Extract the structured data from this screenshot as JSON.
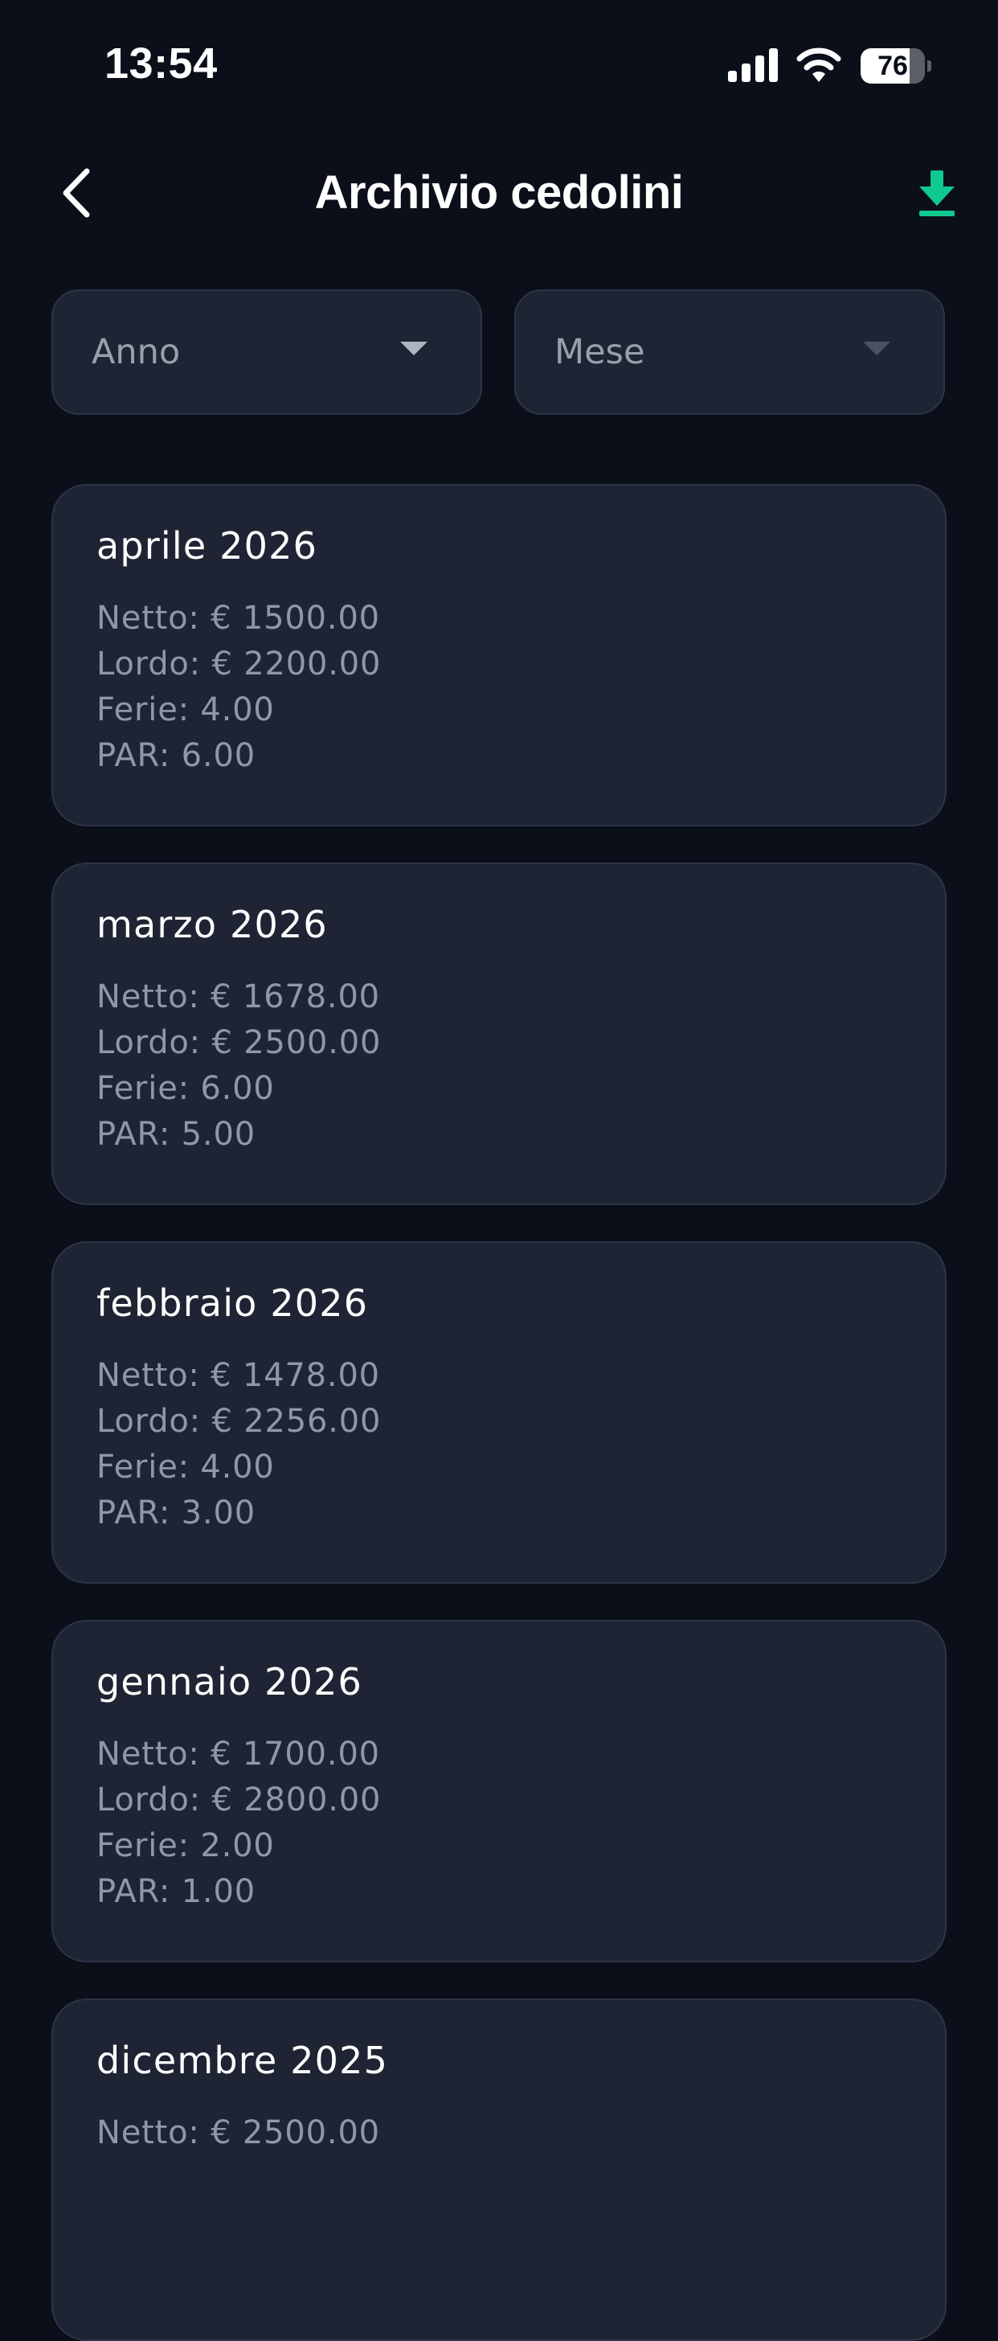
{
  "status_bar": {
    "time": "13:54",
    "battery_percent": "76",
    "battery_level": 0.76,
    "icons": [
      "signal-icon",
      "wifi-icon",
      "battery-icon"
    ]
  },
  "header": {
    "title": "Archivio cedolini",
    "back_icon": "chevron-left-icon",
    "download_icon": "download-icon"
  },
  "filters": {
    "anno": {
      "label": "Anno",
      "icon": "caret-down-icon"
    },
    "mese": {
      "label": "Mese",
      "icon": "caret-down-icon"
    }
  },
  "payslips": [
    {
      "title": "aprile 2026",
      "netto": "Netto: € 1500.00",
      "lordo": "Lordo: € 2200.00",
      "ferie": "Ferie: 4.00",
      "par": "PAR: 6.00"
    },
    {
      "title": "marzo 2026",
      "netto": "Netto: € 1678.00",
      "lordo": "Lordo: € 2500.00",
      "ferie": "Ferie: 6.00",
      "par": "PAR: 5.00"
    },
    {
      "title": "febbraio 2026",
      "netto": "Netto: € 1478.00",
      "lordo": "Lordo: € 2256.00",
      "ferie": "Ferie: 4.00",
      "par": "PAR: 3.00"
    },
    {
      "title": "gennaio 2026",
      "netto": "Netto: € 1700.00",
      "lordo": "Lordo: € 2800.00",
      "ferie": "Ferie: 2.00",
      "par": "PAR: 1.00"
    },
    {
      "title": "dicembre 2025",
      "netto": "Netto: € 2500.00"
    }
  ],
  "colors": {
    "background": "#0a0f1a",
    "card": "#1e2433",
    "card_border": "#2c3446",
    "accent": "#10c98f",
    "secondary_text": "#8d97ad"
  }
}
